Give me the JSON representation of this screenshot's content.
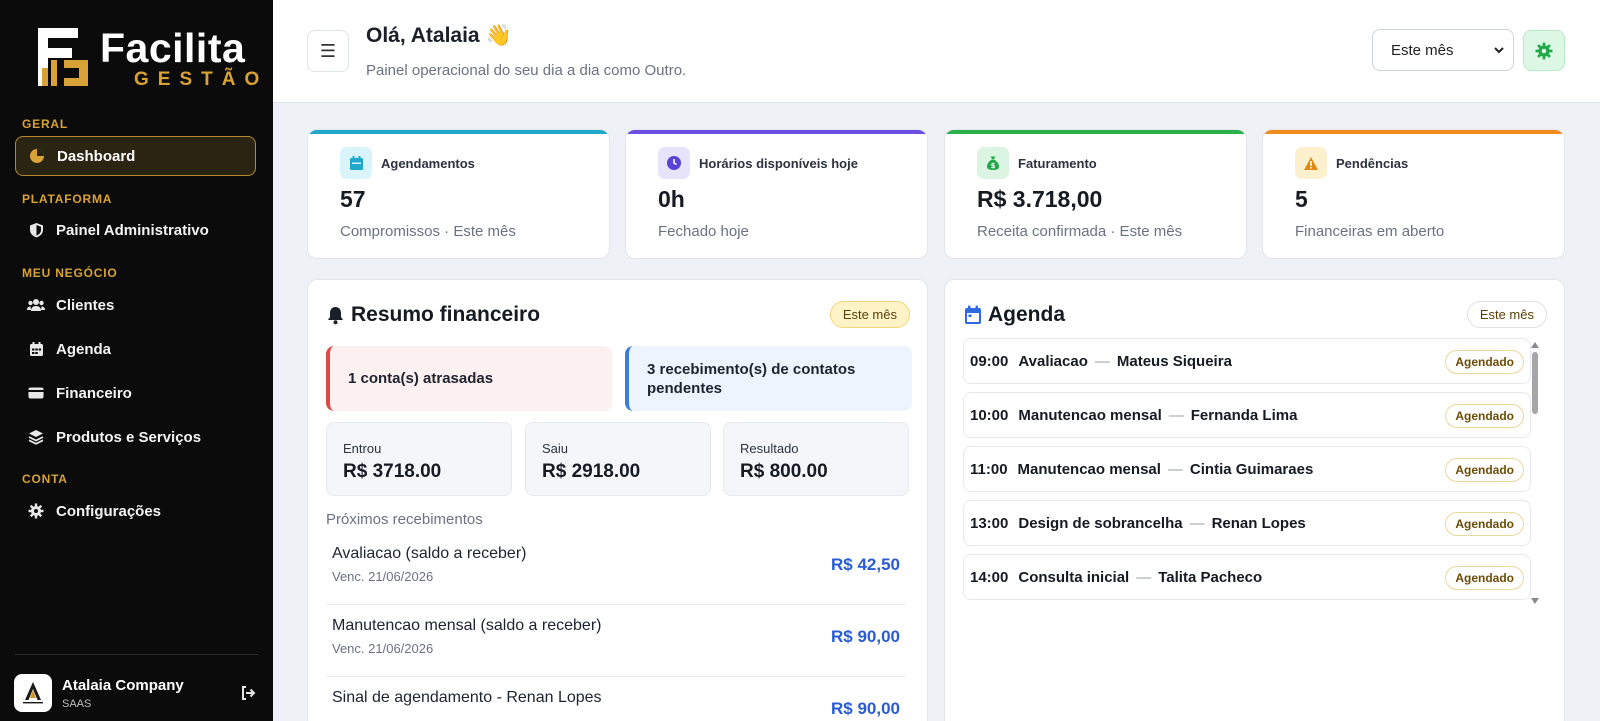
{
  "sidebar": {
    "logo_word": "Facilita",
    "logo_sub": "GESTÃO",
    "sections": {
      "geral": "GERAL",
      "plataforma": "PLATAFORMA",
      "meu_negocio": "MEU NEGÓCIO",
      "conta": "CONTA"
    },
    "items": {
      "dashboard": "Dashboard",
      "painel_admin": "Painel Administrativo",
      "clientes": "Clientes",
      "agenda": "Agenda",
      "financeiro": "Financeiro",
      "produtos": "Produtos e Serviços",
      "configuracoes": "Configurações"
    },
    "company": {
      "name": "Atalaia Company",
      "plan": "SAAS"
    }
  },
  "header": {
    "menu_icon": "☰",
    "greeting": "Olá, Atalaia 👋",
    "subtitle": "Painel operacional do seu dia a dia como Outro.",
    "period_value": "Este mês"
  },
  "stats": [
    {
      "label": "Agendamentos",
      "value": "57",
      "sub": "Compromissos · Este mês",
      "color": "#1fa8c9"
    },
    {
      "label": "Horários disponíveis hoje",
      "value": "0h",
      "sub": "Fechado hoje",
      "color": "#6c4fe0"
    },
    {
      "label": "Faturamento",
      "value": "R$ 3.718,00",
      "sub": "Receita confirmada · Este mês",
      "color": "#2bb04c"
    },
    {
      "label": "Pendências",
      "value": "5",
      "sub": "Financeiras em aberto",
      "color": "#f08c1d"
    }
  ],
  "finance": {
    "title": "Resumo financeiro",
    "period": "Este mês",
    "alert_overdue": "1 conta(s) atrasadas",
    "alert_pending": "3 recebimento(s) de contatos pendentes",
    "entrou_label": "Entrou",
    "entrou_value": "R$ 3718.00",
    "saiu_label": "Saiu",
    "saiu_value": "R$ 2918.00",
    "resultado_label": "Resultado",
    "resultado_value": "R$ 800.00",
    "receivables_title": "Próximos recebimentos",
    "receivables": [
      {
        "name": "Avaliacao (saldo a receber)",
        "due": "Venc. 21/06/2026",
        "amount": "R$ 42,50"
      },
      {
        "name": "Manutencao mensal (saldo a receber)",
        "due": "Venc. 21/06/2026",
        "amount": "R$ 90,00"
      },
      {
        "name": "Sinal de agendamento - Renan Lopes",
        "due": "",
        "amount": "R$ 90,00"
      }
    ]
  },
  "agenda": {
    "title": "Agenda",
    "period": "Este mês",
    "separator": "—",
    "items": [
      {
        "time": "09:00",
        "service": "Avaliacao",
        "client": "Mateus Siqueira",
        "status": "Agendado"
      },
      {
        "time": "10:00",
        "service": "Manutencao mensal",
        "client": "Fernanda Lima",
        "status": "Agendado"
      },
      {
        "time": "11:00",
        "service": "Manutencao mensal",
        "client": "Cintia Guimaraes",
        "status": "Agendado"
      },
      {
        "time": "13:00",
        "service": "Design de sobrancelha",
        "client": "Renan Lopes",
        "status": "Agendado"
      },
      {
        "time": "14:00",
        "service": "Consulta inicial",
        "client": "Talita Pacheco",
        "status": "Agendado"
      }
    ]
  }
}
